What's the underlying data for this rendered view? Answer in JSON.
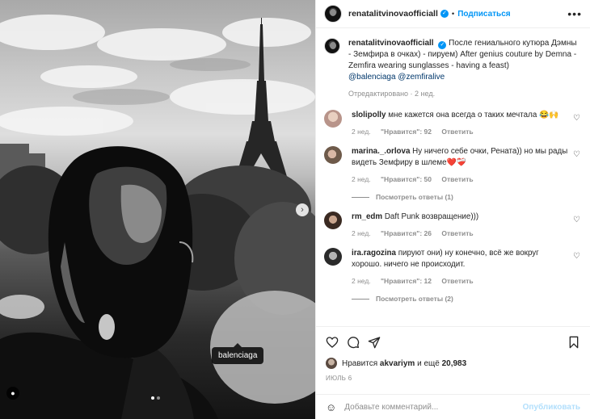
{
  "post": {
    "author": "renatalitvinovaоfıcıall"
  },
  "header": {
    "username": "renatalitvinovaofficiall",
    "separator": "•",
    "follow_label": "Подписаться",
    "more_label": "•••"
  },
  "photo": {
    "tag_label": "balenciaga",
    "slide_count": 2,
    "active_slide": 1
  },
  "caption": {
    "username": "renatalitvinovaofficiall",
    "text": "После гениального кутюра Дэмны - Земфира в очках) - пируем) After genius couture by Demna - Zemfira wearing sunglasses - having a feast)",
    "links": "@balenciaga @zemfiralive",
    "meta": "Отредактировано · 2 нед."
  },
  "comments": [
    {
      "username": "sloliрolly",
      "text": "мне кажется она всегда о таких мечтала 😂🙌",
      "time": "2 нед.",
      "likes": "\"Нравится\": 92",
      "reply": "Ответить",
      "replies": ""
    },
    {
      "username": "marina._.orlova",
      "text": "Ну ничего себе очки, Рената)) но мы рады видеть Земфиру в шлеме❤️❤️‍🩹",
      "time": "2 нед.",
      "likes": "\"Нравится\": 50",
      "reply": "Ответить",
      "replies": "Посмотреть ответы (1)"
    },
    {
      "username": "rm_edm",
      "text": "Daft Punk возвращение)))",
      "time": "2 нед.",
      "likes": "\"Нравится\": 26",
      "reply": "Ответить",
      "replies": ""
    },
    {
      "username": "ira.ragozina",
      "text": "пируют они) ну конечно, всё же вокруг хорошо. ничего не происходит.",
      "time": "2 нед.",
      "likes": "\"Нравится\": 12",
      "reply": "Ответить",
      "replies": "Посмотреть ответы (2)"
    }
  ],
  "actions": {
    "icons": [
      "heart-icon",
      "comment-icon",
      "share-icon",
      "bookmark-icon"
    ],
    "likes_prefix": "Нравится",
    "likes_user": "akvariym",
    "likes_suffix": "и ещё",
    "likes_count": "20,983",
    "date": "ИЮЛЬ 6"
  },
  "add_comment": {
    "placeholder": "Добавьте комментарий...",
    "publish_label": "Опубликовать"
  },
  "colors": {
    "accent": "#0095f6",
    "link": "#00376b",
    "muted": "#8e8e8e",
    "publish_disabled": "#b2dffc"
  }
}
